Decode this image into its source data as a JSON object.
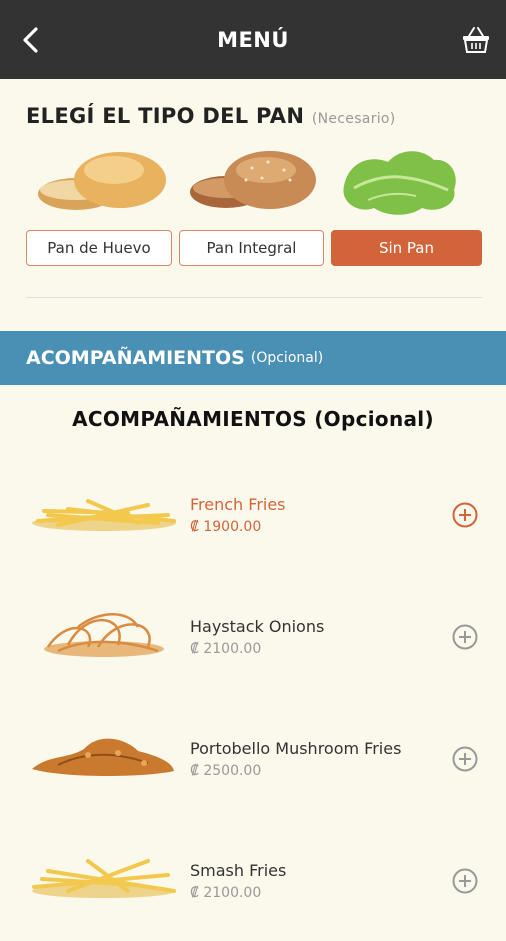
{
  "header": {
    "title": "MENÚ"
  },
  "bread": {
    "title": "ELEGÍ EL TIPO DEL PAN",
    "required": "(Necesario)",
    "options": [
      {
        "label": "Pan de Huevo",
        "selected": false
      },
      {
        "label": "Pan Integral",
        "selected": false
      },
      {
        "label": "Sin Pan",
        "selected": true
      }
    ]
  },
  "sides": {
    "banner_title": "ACOMPAÑAMIENTOS",
    "banner_optional": "(Opcional)",
    "heading": "ACOMPAÑAMIENTOS (Opcional)",
    "items": [
      {
        "name": "French Fries",
        "price": "₡ 1900.00",
        "active": true
      },
      {
        "name": "Haystack Onions",
        "price": "₡ 2100.00",
        "active": false
      },
      {
        "name": "Portobello Mushroom Fries",
        "price": "₡ 2500.00",
        "active": false
      },
      {
        "name": "Smash Fries",
        "price": "₡ 2100.00",
        "active": false
      }
    ]
  },
  "colors": {
    "accent": "#d2643b",
    "banner": "#4a8fb4",
    "topbar": "#333333",
    "background": "#fbf8ec"
  }
}
